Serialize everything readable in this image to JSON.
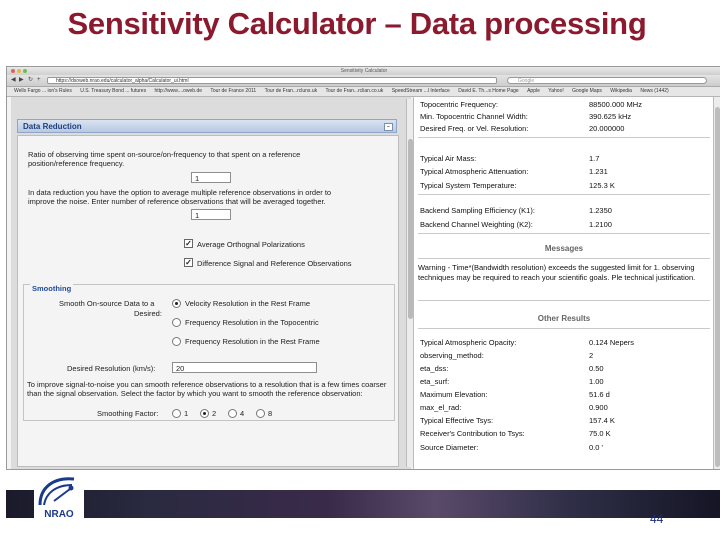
{
  "slide": {
    "title": "Sensitivity Calculator – Data processing",
    "page_number": "44"
  },
  "browser": {
    "window_title": "Sensitivity Calculator",
    "url": "https://dsoweb.nrao.edu/calculator_alpha/Calculator_ui.html",
    "search_placeholder": "Google",
    "bookmarks": [
      "Wells Fargo ... ion's Rules",
      "U.S. Treasury Bond ... futures",
      "http://www....oweb.de",
      "Tour de France 2011",
      "Tour de Fran...rcluns.uk",
      "Tour de Fran...rclian.co.uk",
      "SpeedStream ...l Interface",
      "David E. Th...s Home Page",
      "Apple",
      "Yahoo!",
      "Google Maps",
      "Wikipedia",
      "News (1442)"
    ]
  },
  "data_reduction": {
    "header": "Data Reduction",
    "ratio_label": "Ratio of observing time spent on-source/on-frequency to that spent on a reference position/reference frequency.",
    "ratio_value": "1",
    "average_label": "In data reduction you have the option to average multiple reference observations in order to improve the noise. Enter number of reference observations that will be averaged together.",
    "average_value": "1",
    "checkboxes": [
      {
        "label": "Average Orthognal Polarizations",
        "checked": true
      },
      {
        "label": "Difference Signal and Reference Observations",
        "checked": true
      }
    ],
    "smoothing": {
      "title": "Smoothing",
      "smooth_label_line1": "Smooth On-source Data to a",
      "smooth_label_line2": "Desired:",
      "options": [
        {
          "label": "Velocity Resolution in the Rest Frame",
          "selected": true
        },
        {
          "label": "Frequency Resolution in the Topocentric",
          "selected": false
        },
        {
          "label": "Frequency Resolution in the Rest Frame",
          "selected": false
        }
      ],
      "resolution_label": "Desired Resolution (km/s):",
      "resolution_value": "20",
      "note": "To improve signal-to-noise you can smooth reference observations to a resolution that is a few times coarser than the signal observation. Select the factor by which you want to smooth the reference observation:",
      "factor_label": "Smoothing Factor:",
      "factors": [
        {
          "label": "1",
          "selected": false
        },
        {
          "label": "2",
          "selected": true
        },
        {
          "label": "4",
          "selected": false
        },
        {
          "label": "8",
          "selected": false
        }
      ]
    }
  },
  "results": {
    "top_rows": [
      {
        "label": "Topocentric Frequency:",
        "value": "88500.000 MHz"
      },
      {
        "label": "Min. Topocentric Channel Width:",
        "value": "390.625 kHz"
      },
      {
        "label": "Desired Freq. or Vel. Resolution:",
        "value": "20.000000"
      }
    ],
    "atmos_rows": [
      {
        "label": "Typical Air Mass:",
        "value": "1.7"
      },
      {
        "label": "Typical Atmospheric Attenuation:",
        "value": "1.231"
      },
      {
        "label": "Typical System Temperature:",
        "value": "125.3 K"
      }
    ],
    "backend_rows": [
      {
        "label": "Backend Sampling Efficiency (K1):",
        "value": "1.2350"
      },
      {
        "label": "Backend Channel Weighting (K2):",
        "value": "1.2100"
      }
    ],
    "messages_header": "Messages",
    "warning_text": "Warning - Time*(Bandwidth resolution) exceeds the suggested limit for 1. observing techniques may be required to reach your scientific goals. Ple technical justification.",
    "other_header": "Other Results",
    "other_rows": [
      {
        "label": "Typical Atmospheric Opacity:",
        "value": "0.124 Nepers"
      },
      {
        "label": "observing_method:",
        "value": "2"
      },
      {
        "label": "eta_dss:",
        "value": "0.50"
      },
      {
        "label": "eta_surf:",
        "value": "1.00"
      },
      {
        "label": "Maximum Elevation:",
        "value": "51.6 d"
      },
      {
        "label": "max_el_rad:",
        "value": "0.900"
      },
      {
        "label": "Typical Effective Tsys:",
        "value": "157.4 K"
      },
      {
        "label": "Receiver's Contribution to Tsys:",
        "value": "75.0 K"
      },
      {
        "label": "Source Diameter:",
        "value": "0.0 '"
      }
    ]
  },
  "logo": {
    "text": "NRAO"
  }
}
